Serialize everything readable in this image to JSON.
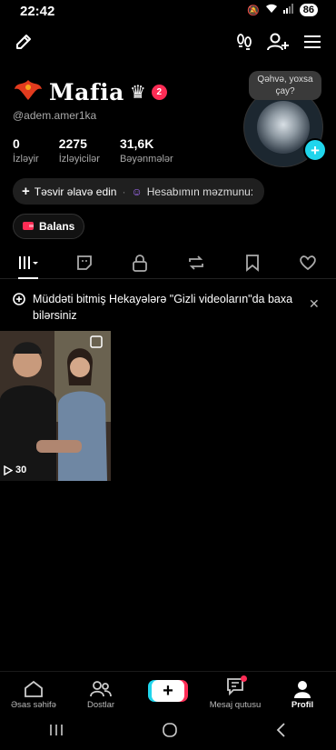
{
  "status_bar": {
    "time": "22:42",
    "battery": "86"
  },
  "profile": {
    "display_name": "Mafia",
    "notification_count": "2",
    "username": "@adem.amer1ka",
    "bubble_text": "Qəhvə, yoxsa çay?"
  },
  "stats": [
    {
      "value": "0",
      "label": "İzləyir"
    },
    {
      "value": "2275",
      "label": "İzləyicilər"
    },
    {
      "value": "31,6K",
      "label": "Bəyənmələr"
    }
  ],
  "actions": {
    "add_bio": "Təsvir əlavə edin",
    "account_content": "Hesabımın məzmunu:",
    "balance": "Balans"
  },
  "notice": {
    "text": "Müddəti bitmiş Hekayələrə \"Gizli videoların\"da baxa bilərsiniz"
  },
  "video": {
    "views": "30"
  },
  "bottom_nav": {
    "home": "Əsas səhifə",
    "friends": "Dostlar",
    "inbox": "Mesaj qutusu",
    "profile": "Profil"
  },
  "colors": {
    "accent_red": "#fe2c55",
    "accent_cyan": "#20d5ec"
  }
}
